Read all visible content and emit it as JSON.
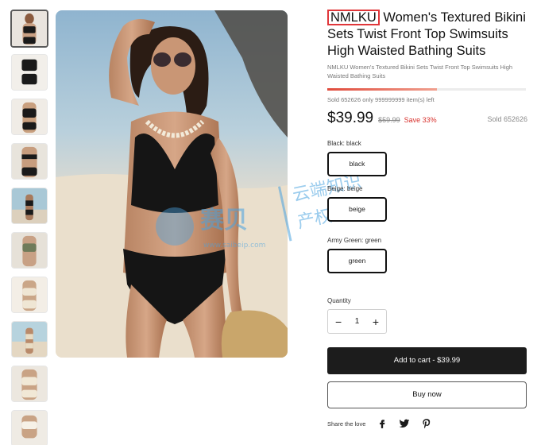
{
  "product": {
    "brand": "NMLKU",
    "title_rest": " Women's Textured Bikini Sets Twist Front Top Swimsuits High Waisted Bathing Suits",
    "subtitle": "NMLKU Women's Textured Bikini Sets Twist Front Top Swimsuits High Waisted Bathing Suits",
    "sold_line": "Sold 652626 only 999999999 item(s) left",
    "price": "$39.99",
    "compare_price": "$59.99",
    "save_text": "Save 33%",
    "sold_right": "Sold 652626"
  },
  "options": [
    {
      "label": "Black:",
      "value": "black",
      "button": "black"
    },
    {
      "label": "Beige:",
      "value": "beige",
      "button": "beige"
    },
    {
      "label": "Army Green:",
      "value": "green",
      "button": "green"
    }
  ],
  "quantity": {
    "label": "Quantity",
    "value": "1",
    "minus": "−",
    "plus": "+"
  },
  "actions": {
    "add_to_cart": "Add to cart - $39.99",
    "buy_now": "Buy now"
  },
  "share": {
    "label": "Share the love",
    "icons": [
      "facebook-icon",
      "twitter-icon",
      "pinterest-icon"
    ]
  },
  "colors": {
    "brand_box": "#e0363a",
    "save": "#d8322e",
    "cart_bg": "#1c1c1c",
    "watermark": "#4aa3e0"
  },
  "thumbnails": [
    "black bikini front",
    "black one-shoulder",
    "black v-neck",
    "black back view",
    "black beach",
    "green top",
    "cream bikini",
    "beige beach",
    "beige top",
    "white top"
  ],
  "watermark": {
    "brand": "赛贝",
    "site": "www.saibeip.com",
    "line1": "云端知识",
    "line2": "产权大平台"
  }
}
